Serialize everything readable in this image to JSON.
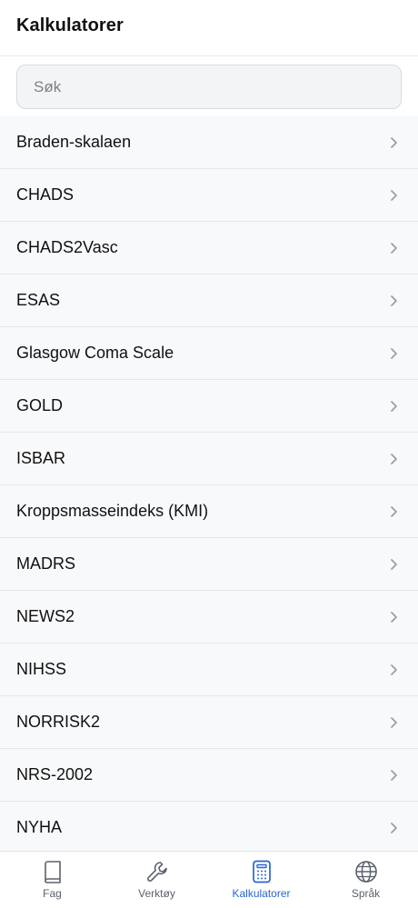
{
  "header": {
    "title": "Kalkulatorer"
  },
  "search": {
    "placeholder": "Søk"
  },
  "list": {
    "items": [
      {
        "label": "Braden-skalaen"
      },
      {
        "label": "CHADS"
      },
      {
        "label": "CHADS2Vasc"
      },
      {
        "label": "ESAS"
      },
      {
        "label": "Glasgow Coma Scale"
      },
      {
        "label": "GOLD"
      },
      {
        "label": "ISBAR"
      },
      {
        "label": "Kroppsmasseindeks (KMI)"
      },
      {
        "label": "MADRS"
      },
      {
        "label": "NEWS2"
      },
      {
        "label": "NIHSS"
      },
      {
        "label": "NORRISK2"
      },
      {
        "label": "NRS-2002"
      },
      {
        "label": "NYHA"
      }
    ]
  },
  "tabbar": {
    "tabs": [
      {
        "label": "Fag",
        "icon": "book-icon",
        "active": false
      },
      {
        "label": "Verktøy",
        "icon": "wrench-icon",
        "active": false
      },
      {
        "label": "Kalkulatorer",
        "icon": "calculator-icon",
        "active": true
      },
      {
        "label": "Språk",
        "icon": "globe-icon",
        "active": false
      }
    ]
  },
  "colors": {
    "accent": "#2a63d4",
    "inactive": "#5b616b",
    "chevron": "#9aa0a6"
  }
}
